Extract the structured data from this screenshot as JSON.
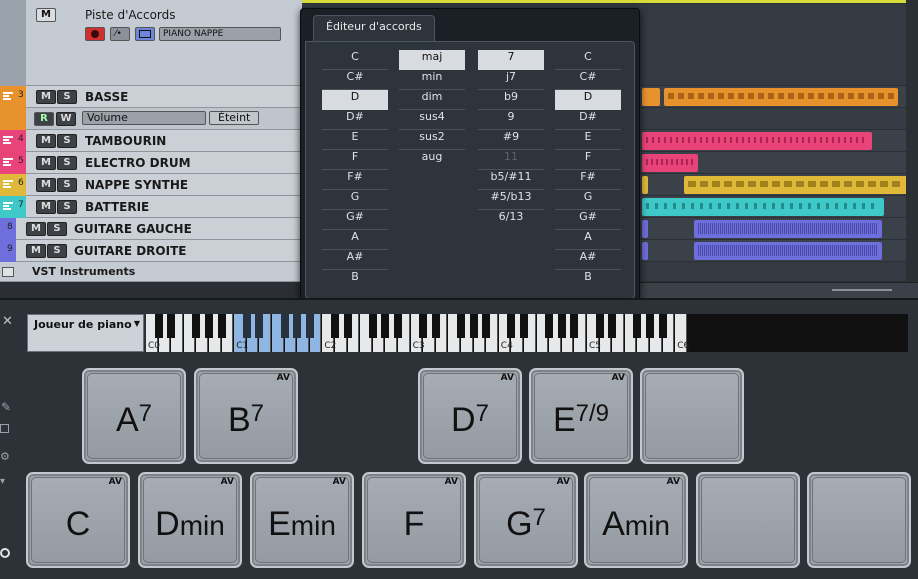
{
  "chord_track": {
    "name": "Piste d'Accords",
    "instrument": "PIANO NAPPE",
    "mute_label": "M"
  },
  "tracks": [
    {
      "num": "3",
      "name": "BASSE",
      "color": "#e8922e"
    },
    {
      "num": "4",
      "name": "TAMBOURIN",
      "color": "#e8447a"
    },
    {
      "num": "5",
      "name": "ELECTRO DRUM",
      "color": "#e8447a"
    },
    {
      "num": "6",
      "name": "NAPPE SYNTHE",
      "color": "#e0b83a"
    },
    {
      "num": "7",
      "name": "BATTERIE",
      "color": "#3ec8c8"
    },
    {
      "num": "8",
      "name": "GUITARE GAUCHE",
      "color": "#6e6edc"
    },
    {
      "num": "9",
      "name": "GUITARE DROITE",
      "color": "#6e6edc"
    }
  ],
  "automation": {
    "r": "R",
    "w": "W",
    "param": "Volume",
    "state": "Éteint"
  },
  "buttons": {
    "m": "M",
    "s": "S"
  },
  "vst_label": "VST Instruments",
  "chord_editor": {
    "title": "Éditeur d'accords",
    "roots": [
      "C",
      "C#",
      "D",
      "D#",
      "E",
      "F",
      "F#",
      "G",
      "G#",
      "A",
      "A#",
      "B"
    ],
    "types": [
      "maj",
      "min",
      "dim",
      "sus4",
      "sus2",
      "aug"
    ],
    "tensions": [
      "7",
      "j7",
      "b9",
      "9",
      "#9",
      "11",
      "b5/#11",
      "#5/b13",
      "6/13"
    ],
    "bass": [
      "C",
      "C#",
      "D",
      "D#",
      "E",
      "F",
      "F#",
      "G",
      "G#",
      "A",
      "A#",
      "B"
    ]
  },
  "player": {
    "label": "Joueur de piano"
  },
  "keyboard": {
    "octaves": [
      "C0",
      "C1",
      "C2",
      "C3",
      "C4",
      "C5",
      "C6"
    ]
  },
  "pads_top": [
    {
      "root": "A",
      "sup": "7",
      "small": "",
      "av": ""
    },
    {
      "root": "B",
      "sup": "7",
      "small": "",
      "av": "AV"
    },
    {
      "root": "D",
      "sup": "7",
      "small": "",
      "av": "AV"
    },
    {
      "root": "E",
      "sup": "7/9",
      "small": "",
      "av": "AV"
    },
    {
      "root": "",
      "sup": "",
      "small": "",
      "av": ""
    }
  ],
  "pads_bottom": [
    {
      "root": "C",
      "sup": "",
      "small": "",
      "av": "AV"
    },
    {
      "root": "D",
      "sup": "",
      "small": "min",
      "av": "AV"
    },
    {
      "root": "E",
      "sup": "",
      "small": "min",
      "av": "AV"
    },
    {
      "root": "F",
      "sup": "",
      "small": "",
      "av": "AV"
    },
    {
      "root": "G",
      "sup": "7",
      "small": "",
      "av": "AV"
    },
    {
      "root": "A",
      "sup": "",
      "small": "min",
      "av": "AV"
    },
    {
      "root": "",
      "sup": "",
      "small": "",
      "av": ""
    },
    {
      "root": "",
      "sup": "",
      "small": "",
      "av": ""
    }
  ]
}
